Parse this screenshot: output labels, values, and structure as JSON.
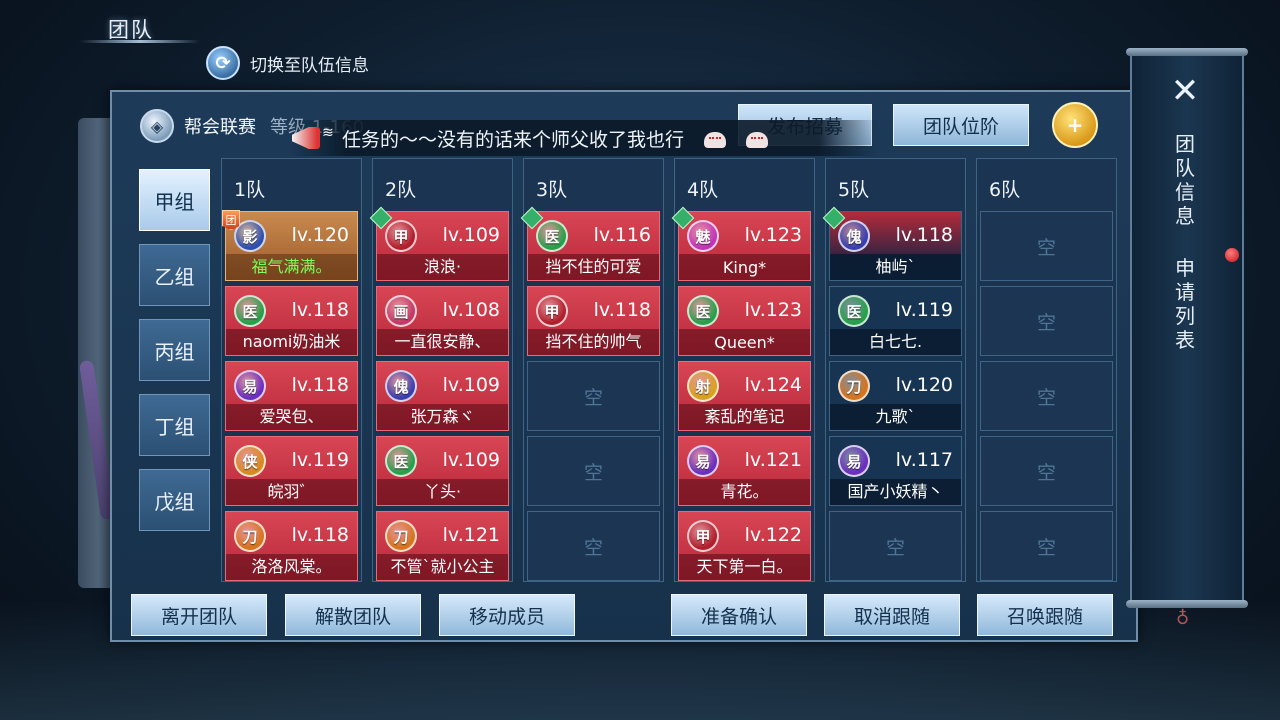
{
  "page": {
    "title": "团队",
    "switch_label": "切换至队伍信息"
  },
  "header": {
    "league_name": "帮会联赛",
    "league_level": "等级 1-160",
    "scroll_message": "任务的～～没有的话来个师父收了我也行",
    "recruit_label": "发布招募",
    "rank_label": "团队位阶",
    "add_icon": "add-friend-icon"
  },
  "groups": [
    {
      "label": "甲组",
      "active": true
    },
    {
      "label": "乙组",
      "active": false
    },
    {
      "label": "丙组",
      "active": false
    },
    {
      "label": "丁组",
      "active": false
    },
    {
      "label": "戊组",
      "active": false
    }
  ],
  "empty_label": "空",
  "teams": [
    {
      "label": "1队",
      "members": [
        {
          "sect": "影",
          "sect_color": "#2d4fb0",
          "level": "lv.120",
          "name": "福气满满。",
          "style": "gold",
          "name_color": "green",
          "badge": "团"
        },
        {
          "sect": "医",
          "sect_color": "#27a04a",
          "level": "lv.118",
          "name": "naomi奶油米",
          "style": "red"
        },
        {
          "sect": "易",
          "sect_color": "#6a2fc0",
          "level": "lv.118",
          "name": "爱哭包、",
          "style": "red"
        },
        {
          "sect": "侠",
          "sect_color": "#d88a1e",
          "level": "lv.119",
          "name": "皖羽゛",
          "style": "red"
        },
        {
          "sect": "刀",
          "sect_color": "#d8741e",
          "level": "lv.118",
          "name": "洛洛风棠。",
          "style": "red"
        }
      ]
    },
    {
      "label": "2队",
      "members": [
        {
          "sect": "甲",
          "sect_color": "#b01f2c",
          "level": "lv.109",
          "name": "浪浪·",
          "style": "red",
          "badge": "captain"
        },
        {
          "sect": "画",
          "sect_color": "#c23a66",
          "level": "lv.108",
          "name": "一直很安静、",
          "style": "red"
        },
        {
          "sect": "傀",
          "sect_color": "#3a3fb0",
          "level": "lv.109",
          "name": "张万森ヾ",
          "style": "red"
        },
        {
          "sect": "医",
          "sect_color": "#27a04a",
          "level": "lv.109",
          "name": "丫头·",
          "style": "red"
        },
        {
          "sect": "刀",
          "sect_color": "#d8741e",
          "level": "lv.121",
          "name": "不管`就小公主",
          "style": "red"
        }
      ]
    },
    {
      "label": "3队",
      "members": [
        {
          "sect": "医",
          "sect_color": "#27a04a",
          "level": "lv.116",
          "name": "挡不住的可爱",
          "style": "red",
          "badge": "captain"
        },
        {
          "sect": "甲",
          "sect_color": "#b01f2c",
          "level": "lv.118",
          "name": "挡不住的帅气",
          "style": "red"
        }
      ]
    },
    {
      "label": "4队",
      "members": [
        {
          "sect": "魅",
          "sect_color": "#c035b8",
          "level": "lv.123",
          "name": "King*",
          "style": "red",
          "badge": "captain"
        },
        {
          "sect": "医",
          "sect_color": "#27a04a",
          "level": "lv.123",
          "name": "Queen*",
          "style": "red"
        },
        {
          "sect": "射",
          "sect_color": "#d8a21e",
          "level": "lv.124",
          "name": "紊乱的笔记",
          "style": "red"
        },
        {
          "sect": "易",
          "sect_color": "#6a2fc0",
          "level": "lv.121",
          "name": "青花。",
          "style": "red"
        },
        {
          "sect": "甲",
          "sect_color": "#b01f2c",
          "level": "lv.122",
          "name": "天下第一白。",
          "style": "red"
        }
      ]
    },
    {
      "label": "5队",
      "members": [
        {
          "sect": "傀",
          "sect_color": "#3a3fb0",
          "level": "lv.118",
          "name": "柚屿`",
          "style": "dark",
          "badge": "captain"
        },
        {
          "sect": "医",
          "sect_color": "#27a04a",
          "level": "lv.119",
          "name": "白七七.",
          "style": "navy"
        },
        {
          "sect": "刀",
          "sect_color": "#d8741e",
          "level": "lv.120",
          "name": "九歌`",
          "style": "navy"
        },
        {
          "sect": "易",
          "sect_color": "#6a2fc0",
          "level": "lv.117",
          "name": "国产小妖精丶",
          "style": "navy"
        }
      ]
    },
    {
      "label": "6队",
      "members": []
    }
  ],
  "actions": {
    "leave": "离开团队",
    "disband": "解散团队",
    "move": "移动成员",
    "ready": "准备确认",
    "unfollow": "取消跟随",
    "summon": "召唤跟随"
  },
  "side": {
    "tab_info": "团队信息",
    "tab_apply": "申请列表"
  }
}
